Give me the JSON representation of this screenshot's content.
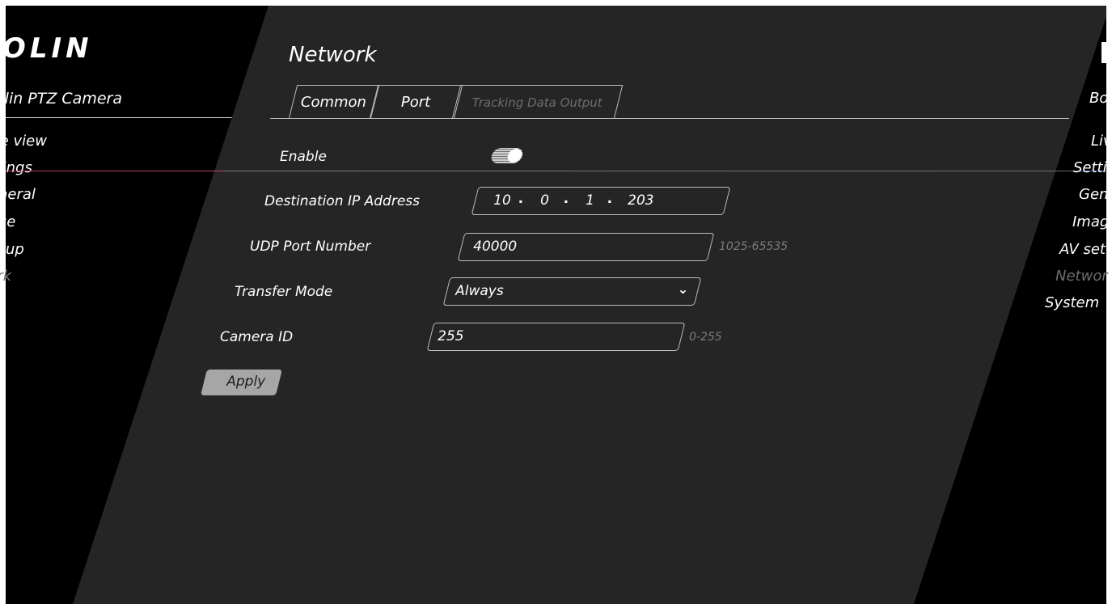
{
  "brand": {
    "logo_text": "BOLIN",
    "product": "Bolin PTZ Camera"
  },
  "left_nav": {
    "live_view": "Live view",
    "settings": "Settings",
    "general": "General",
    "image": "Image",
    "av_setup": "AV setup",
    "network": "Network"
  },
  "right_nav": {
    "brand": "Bo",
    "live": "Liv",
    "settings": "Setti",
    "general": "Gen",
    "image": "Imag",
    "av": "AV set",
    "network": "Networ",
    "system": "System"
  },
  "page": {
    "title": "Network",
    "tabs": [
      {
        "label": "Common",
        "active": false
      },
      {
        "label": "Port",
        "active": false
      },
      {
        "label": "Tracking Data Output",
        "active": true
      }
    ]
  },
  "form": {
    "enable_label": "Enable",
    "enable_value": true,
    "dest_ip_label": "Destination IP Address",
    "ip": [
      "10",
      "0",
      "1",
      "203"
    ],
    "udp_label": "UDP Port Number",
    "udp_value": "40000",
    "udp_hint": "1025-65535",
    "transfer_label": "Transfer Mode",
    "transfer_value": "Always",
    "camera_id_label": "Camera ID",
    "camera_id_value": "255",
    "camera_id_hint": "0-255",
    "apply_label": "Apply"
  },
  "colors": {
    "panel": "#252525",
    "background": "#000000",
    "inactive_tab_text": "#6d6d6d",
    "hint": "#7c7c7c",
    "button": "#a6a6a6"
  }
}
